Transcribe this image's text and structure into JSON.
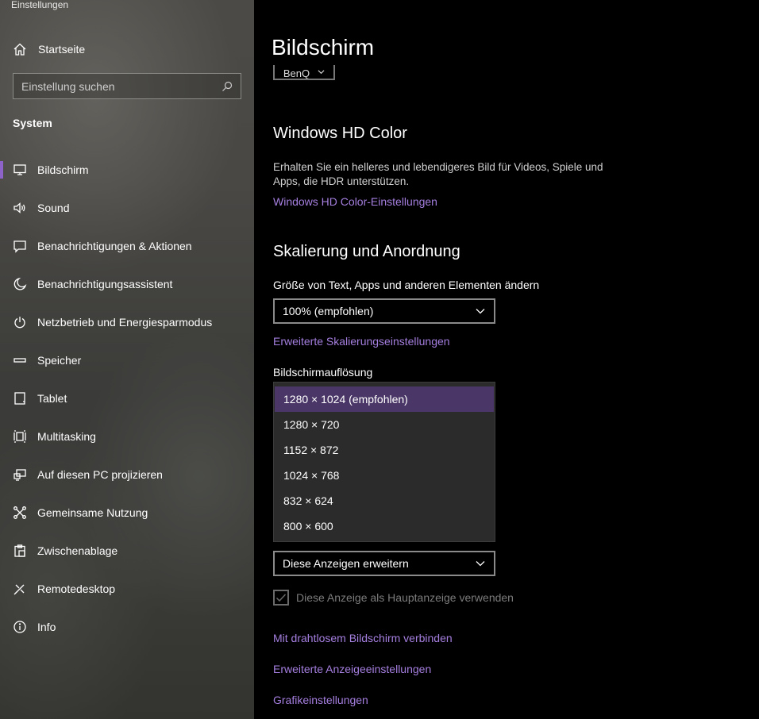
{
  "app": {
    "title": "Einstellungen"
  },
  "sidebar": {
    "home_label": "Startseite",
    "search_placeholder": "Einstellung suchen",
    "section_title": "System",
    "items": [
      {
        "label": "Bildschirm",
        "icon": "monitor-icon",
        "active": true
      },
      {
        "label": "Sound",
        "icon": "speaker-icon",
        "active": false
      },
      {
        "label": "Benachrichtigungen & Aktionen",
        "icon": "message-icon",
        "active": false
      },
      {
        "label": "Benachrichtigungsassistent",
        "icon": "moon-icon",
        "active": false
      },
      {
        "label": "Netzbetrieb und Energiesparmodus",
        "icon": "power-icon",
        "active": false
      },
      {
        "label": "Speicher",
        "icon": "storage-icon",
        "active": false
      },
      {
        "label": "Tablet",
        "icon": "tablet-icon",
        "active": false
      },
      {
        "label": "Multitasking",
        "icon": "multitasking-icon",
        "active": false
      },
      {
        "label": "Auf diesen PC projizieren",
        "icon": "project-icon",
        "active": false
      },
      {
        "label": "Gemeinsame Nutzung",
        "icon": "share-icon",
        "active": false
      },
      {
        "label": "Zwischenablage",
        "icon": "clipboard-icon",
        "active": false
      },
      {
        "label": "Remotedesktop",
        "icon": "remote-desktop-icon",
        "active": false
      },
      {
        "label": "Info",
        "icon": "info-icon",
        "active": false
      }
    ]
  },
  "main": {
    "title": "Bildschirm",
    "monitor_button": "BenQ",
    "hdr": {
      "heading": "Windows HD Color",
      "description": "Erhalten Sie ein helleres und lebendigeres Bild für Videos, Spiele und Apps, die HDR unterstützen.",
      "link": "Windows HD Color-Einstellungen"
    },
    "scaling": {
      "heading": "Skalierung und Anordnung",
      "size_label": "Größe von Text, Apps und anderen Elementen ändern",
      "size_value": "100% (empfohlen)",
      "advanced_link": "Erweiterte Skalierungseinstellungen",
      "resolution_label": "Bildschirmauflösung",
      "resolution_options": [
        "1280 × 1024 (empfohlen)",
        "1280 × 720",
        "1152 × 872",
        "1024 × 768",
        "832 × 624",
        "800 × 600"
      ],
      "resolution_selected_index": 0,
      "multi_display_value": "Diese Anzeigen erweitern",
      "main_display_label": "Diese Anzeige als Hauptanzeige verwenden",
      "main_display_checked": true
    },
    "links": {
      "wireless": "Mit drahtlosem Bildschirm verbinden",
      "advanced_display": "Erweiterte Anzeigeeinstellungen",
      "graphics": "Grafikeinstellungen"
    },
    "accent_color": "#a57fe0",
    "selection_color": "#4a3767"
  }
}
